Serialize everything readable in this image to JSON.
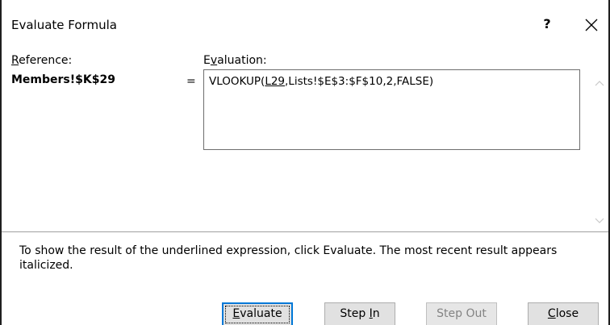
{
  "window": {
    "title": "Evaluate Formula",
    "help_label": "?"
  },
  "labels": {
    "reference_first": "R",
    "reference_rest": "eference:",
    "evaluation_first": "E",
    "evaluation_underlined": "v",
    "evaluation_rest": "aluation:"
  },
  "reference_value": "Members!$K$29",
  "equals": "=",
  "evaluation": {
    "prefix": "VLOOKUP(",
    "underlined": "L29",
    "suffix": ",Lists!$E$3:$F$10,2,FALSE)"
  },
  "info_text": "To show the result of the underlined expression, click Evaluate.  The most recent result appears italicized.",
  "buttons": {
    "evaluate_hotkey": "E",
    "evaluate_rest": "valuate",
    "stepin_prefix": "Step ",
    "stepin_hotkey": "I",
    "stepin_rest": "n",
    "stepout": "Step Out",
    "close_hotkey": "C",
    "close_rest": "lose"
  },
  "icons": {
    "close": "close-icon",
    "scroll_up": "scroll-up-arrow-icon",
    "scroll_down": "scroll-down-arrow-icon"
  }
}
